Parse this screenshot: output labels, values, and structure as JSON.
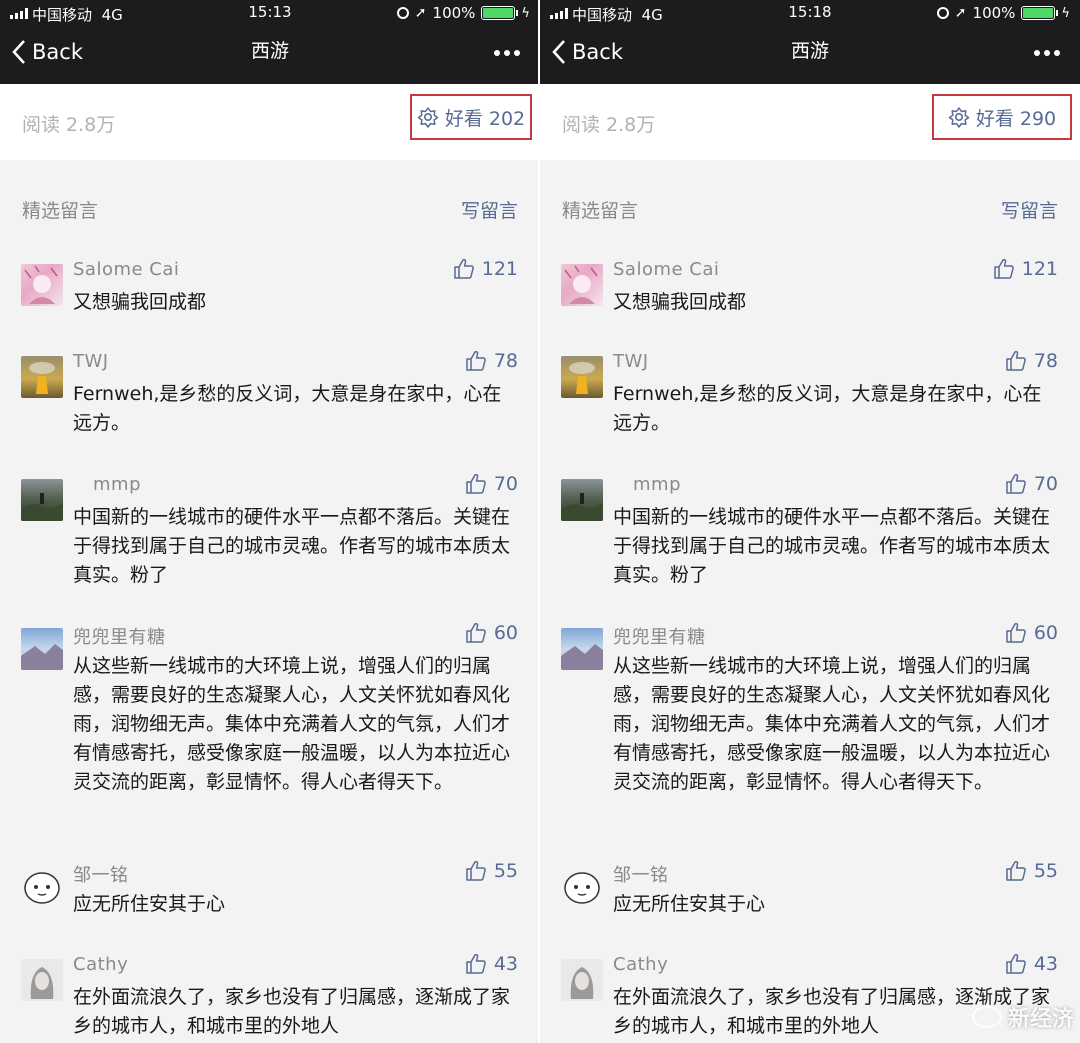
{
  "panels": [
    {
      "status": {
        "carrier": "中国移动",
        "network": "4G",
        "time": "15:13",
        "battery": "100%"
      },
      "nav": {
        "back_label": "Back",
        "title": "西游"
      },
      "read": {
        "label": "阅读 2.8万"
      },
      "haokan": {
        "label": "好看 202"
      },
      "section": {
        "label": "精选留言",
        "write_label": "写留言"
      },
      "comments": [
        {
          "name": "Salome Cai",
          "likes": "121",
          "text": "又想骗我回成都"
        },
        {
          "name": "TWJ",
          "likes": "78",
          "text": "Fernweh,是乡愁的反义词，大意是身在家中，心在远方。"
        },
        {
          "name": "mmp",
          "likes": "70",
          "text": "中国新的一线城市的硬件水平一点都不落后。关键在于得找到属于自己的城市灵魂。作者写的城市本质太真实。粉了"
        },
        {
          "name": "兜兜里有糖",
          "likes": "60",
          "text": "从这些新一线城市的大环境上说，增强人们的归属感，需要良好的生态凝聚人心，人文关怀犹如春风化雨，润物细无声。集体中充满着人文的气氛，人们才有情感寄托，感受像家庭一般温暖，以人为本拉近心灵交流的距离，彰显情怀。得人心者得天下。"
        },
        {
          "name": "邹一铭",
          "likes": "55",
          "text": "应无所住安其于心"
        },
        {
          "name": "Cathy",
          "likes": "43",
          "text": "在外面流浪久了，家乡也没有了归属感，逐渐成了家乡的城市人，和城市里的外地人"
        }
      ]
    },
    {
      "status": {
        "carrier": "中国移动",
        "network": "4G",
        "time": "15:18",
        "battery": "100%"
      },
      "nav": {
        "back_label": "Back",
        "title": "西游"
      },
      "read": {
        "label": "阅读 2.8万"
      },
      "haokan": {
        "label": "好看 290"
      },
      "section": {
        "label": "精选留言",
        "write_label": "写留言"
      },
      "comments": [
        {
          "name": "Salome Cai",
          "likes": "121",
          "text": "又想骗我回成都"
        },
        {
          "name": "TWJ",
          "likes": "78",
          "text": "Fernweh,是乡愁的反义词，大意是身在家中，心在远方。"
        },
        {
          "name": "mmp",
          "likes": "70",
          "text": "中国新的一线城市的硬件水平一点都不落后。关键在于得找到属于自己的城市灵魂。作者写的城市本质太真实。粉了"
        },
        {
          "name": "兜兜里有糖",
          "likes": "60",
          "text": "从这些新一线城市的大环境上说，增强人们的归属感，需要良好的生态凝聚人心，人文关怀犹如春风化雨，润物细无声。集体中充满着人文的气氛，人们才有情感寄托，感受像家庭一般温暖，以人为本拉近心灵交流的距离，彰显情怀。得人心者得天下。"
        },
        {
          "name": "邹一铭",
          "likes": "55",
          "text": "应无所住安其于心"
        },
        {
          "name": "Cathy",
          "likes": "43",
          "text": "在外面流浪久了，家乡也没有了归属感，逐渐成了家乡的城市人，和城市里的外地人"
        }
      ]
    }
  ],
  "watermark": {
    "text": "新经济"
  },
  "colors": {
    "nav_bg": "#1c1c1e",
    "link": "#576b95",
    "highlight_box": "#c23a40",
    "battery": "#4cd964"
  },
  "icons": [
    "signal-icon",
    "location-arrow-icon",
    "battery-icon",
    "chevron-left-icon",
    "more-dots-icon",
    "haokan-flower-icon",
    "thumbs-up-icon",
    "wechat-icon"
  ]
}
